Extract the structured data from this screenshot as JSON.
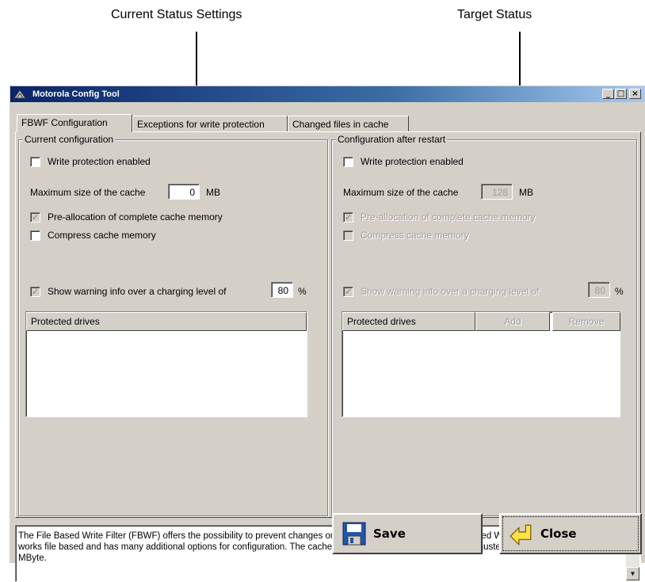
{
  "callouts": {
    "current": "Current Status Settings",
    "target": "Target Status"
  },
  "window": {
    "title": "Motorola Config Tool",
    "controls": {
      "minimize": "_",
      "maximize": "□",
      "close": "×"
    }
  },
  "tabs": [
    {
      "label": "FBWF Configuration",
      "active": true
    },
    {
      "label": "Exceptions for write protection",
      "active": false
    },
    {
      "label": "Changed files in cache",
      "active": false
    }
  ],
  "current": {
    "group_title": "Current configuration",
    "write_protection": {
      "label": "Write protection enabled",
      "checked": false
    },
    "cache_label": "Maximum size of the cache",
    "cache_value": "0",
    "cache_unit": "MB",
    "prealloc": {
      "label": "Pre-allocation of complete cache memory",
      "checked": true
    },
    "compress": {
      "label": "Compress cache memory",
      "checked": false
    },
    "warning": {
      "label": "Show warning info over a charging level of",
      "checked": true
    },
    "warning_value": "80",
    "warning_unit": "%",
    "drives_header": "Protected drives"
  },
  "target": {
    "group_title": "Configuration after restart",
    "write_protection": {
      "label": "Write protection enabled",
      "checked": false
    },
    "cache_label": "Maximum size of the cache",
    "cache_value": "128",
    "cache_unit": "MB",
    "prealloc": {
      "label": "Pre-allocation of complete cache memory",
      "checked": true
    },
    "compress": {
      "label": "Compress cache memory",
      "checked": false
    },
    "warning": {
      "label": "Show warning info over a charging level of",
      "checked": true
    },
    "warning_value": "80",
    "warning_unit": "%",
    "drives_header": "Protected drives",
    "add_label": "Add",
    "remove_label": "Remove"
  },
  "description": "The File Based Write Filter (FBWF) offers the possibility to prevent changes on partitions. In contrast to the Enhanced Write Filter (EWF) the FBWF works file based and has many additional options for configuration. The cache size for buffering changes can be adjusted between 64 and max. 1024 MByte.",
  "buttons": {
    "save": "Save",
    "close": "Close"
  },
  "icons": {
    "save": "floppy-disk-icon",
    "close": "exit-arrow-icon"
  }
}
